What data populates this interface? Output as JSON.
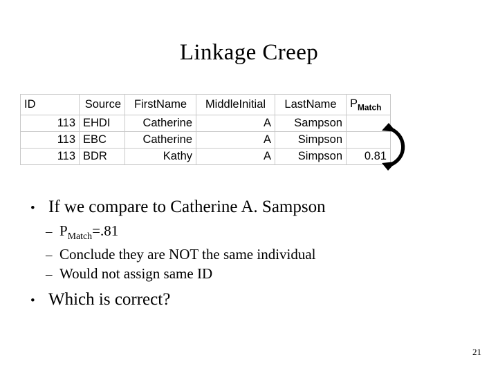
{
  "slide": {
    "title": "Linkage Creep",
    "page_number": "21"
  },
  "table": {
    "headers": {
      "id": "ID",
      "source": "Source",
      "first_name": "FirstName",
      "middle_initial": "MiddleInitial",
      "last_name": "LastName",
      "pmatch_base": "P",
      "pmatch_sub": "Match"
    },
    "rows": [
      {
        "id": "113",
        "source": "EHDI",
        "first_name": "Catherine",
        "middle_initial": "A",
        "last_name": "Sampson",
        "pmatch": ""
      },
      {
        "id": "113",
        "source": "EBC",
        "first_name": "Catherine",
        "middle_initial": "A",
        "last_name": "Simpson",
        "pmatch": ""
      },
      {
        "id": "113",
        "source": "BDR",
        "first_name": "Kathy",
        "middle_initial": "A",
        "last_name": "Simpson",
        "pmatch": "0.81"
      }
    ],
    "pmatch_highlight_color": "#0000c8",
    "border_color": "#c8c8c8"
  },
  "annotation": {
    "arrow_name": "curved-double-headed-arrow",
    "arrow_color": "#000000"
  },
  "bullets": {
    "level1_mark": "•",
    "level2_mark": "–",
    "items": [
      {
        "text": "If we compare to Catherine A. Sampson",
        "sub_items": [
          {
            "base": "P",
            "subscript": "Match",
            "tail": "=.81"
          },
          {
            "text": "Conclude they are NOT the same individual"
          },
          {
            "text": "Would not assign same ID"
          }
        ]
      },
      {
        "text": "Which is correct?",
        "sub_items": []
      }
    ]
  }
}
